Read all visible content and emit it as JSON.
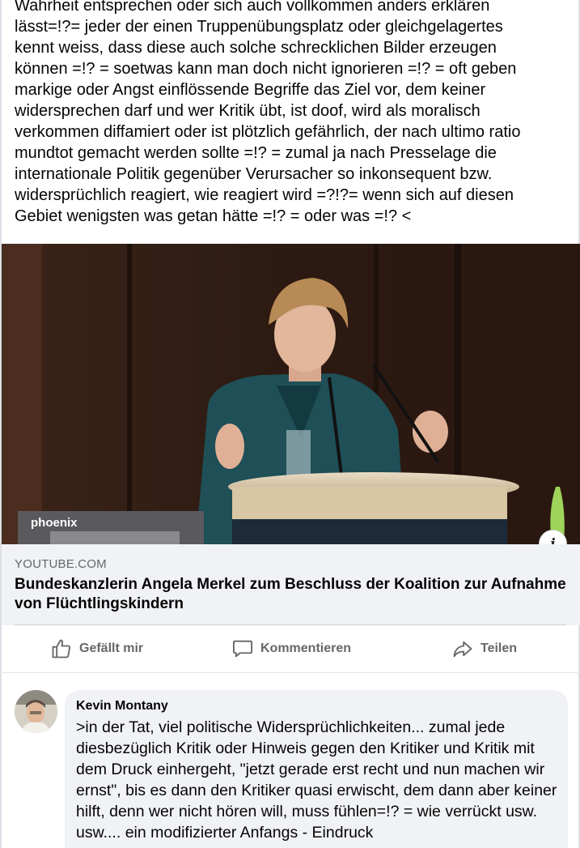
{
  "post": {
    "text_lines": [
      "Wahrheit entsprechen oder sich auch vollkommen anders erklären",
      "lässt=!?= jeder der einen Truppenübungsplatz oder gleichgelagertes",
      "kennt weiss, dass diese auch solche schrecklichen Bilder erzeugen",
      "können =!? = soetwas kann man doch nicht ignorieren =!? = oft geben",
      "markige oder Angst einflössende Begriffe das Ziel vor, dem keiner",
      "widersprechen darf und wer Kritik übt, ist doof, wird als moralisch",
      "verkommen diffamiert oder ist plötzlich gefährlich, der nach ultimo ratio",
      "mundtot gemacht werden sollte =!? = zumal ja nach Presselage die",
      "internationale Politik gegenüber Verursacher so inkonsequent bzw.",
      "widersprüchlich reagiert, wie reagiert wird =?!?= wenn sich auf diesen",
      "Gebiet wenigsten was getan hätte =!? = oder was =!? <"
    ]
  },
  "link_preview": {
    "image_watermark": "phoenix",
    "info_icon": "info-icon",
    "domain": "YOUTUBE.COM",
    "title": "Bundeskanzlerin Angela Merkel zum Beschluss der Koalition zur Aufnahme von Flüchtlingskindern"
  },
  "actions": {
    "like_label": "Gefällt mir",
    "like_icon": "thumbs-up-icon",
    "comment_label": "Kommentieren",
    "comment_icon": "speech-bubble-icon",
    "share_label": "Teilen",
    "share_icon": "share-arrow-icon"
  },
  "comment": {
    "author": "Kevin Montany",
    "text": ">in der Tat, viel politische Widersprüchlichkeiten... zumal jede diesbezüglich Kritik oder Hinweis gegen den Kritiker und Kritik mit dem Druck einhergeht, \"jetzt gerade erst recht und nun machen wir ernst\", bis es dann den Kritiker quasi erwischt, dem dann aber keiner hilft, denn wer nicht hören will, muss fühlen=!? = wie verrückt usw. usw.... ein modifizierter Anfangs - Eindruck"
  },
  "colors": {
    "text_primary": "#050505",
    "text_secondary": "#65676b",
    "meta_background": "#f0f2f5",
    "jacket": "#1f4f57"
  }
}
